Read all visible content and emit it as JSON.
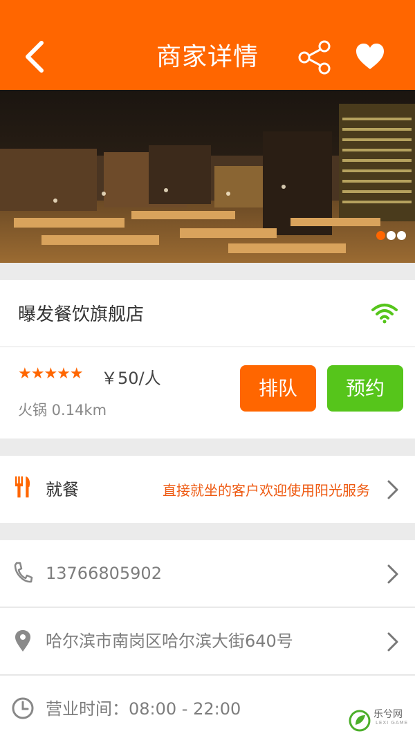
{
  "header": {
    "title": "商家详情",
    "back_icon": "chevron-left-icon",
    "share_icon": "share-icon",
    "favorite_icon": "heart-icon",
    "background": "#ff6600"
  },
  "banner": {
    "image": "restaurant-interior-photo",
    "slide_count": 3,
    "active_slide": 1
  },
  "shop": {
    "name": "曝发餐饮旗舰店",
    "wifi_icon": "wifi-icon",
    "rating_stars": "★★★★★",
    "rating": 5,
    "price": "￥50/人",
    "category_distance": "火锅  0.14km"
  },
  "actions": {
    "queue_label": "排队",
    "reserve_label": "预约",
    "queue_color": "#ff6600",
    "reserve_color": "#56c51b"
  },
  "dining": {
    "label": "就餐",
    "promo": "直接就坐的客户欢迎使用阳光服务",
    "icon": "fork-knife-icon"
  },
  "contacts": {
    "phone": "13766805902",
    "address": "哈尔滨市南岗区哈尔滨大街640号",
    "hours": "营业时间：08:00 - 22:00"
  },
  "watermark": {
    "brand": "乐兮网",
    "sub": "LEXI GAME"
  }
}
